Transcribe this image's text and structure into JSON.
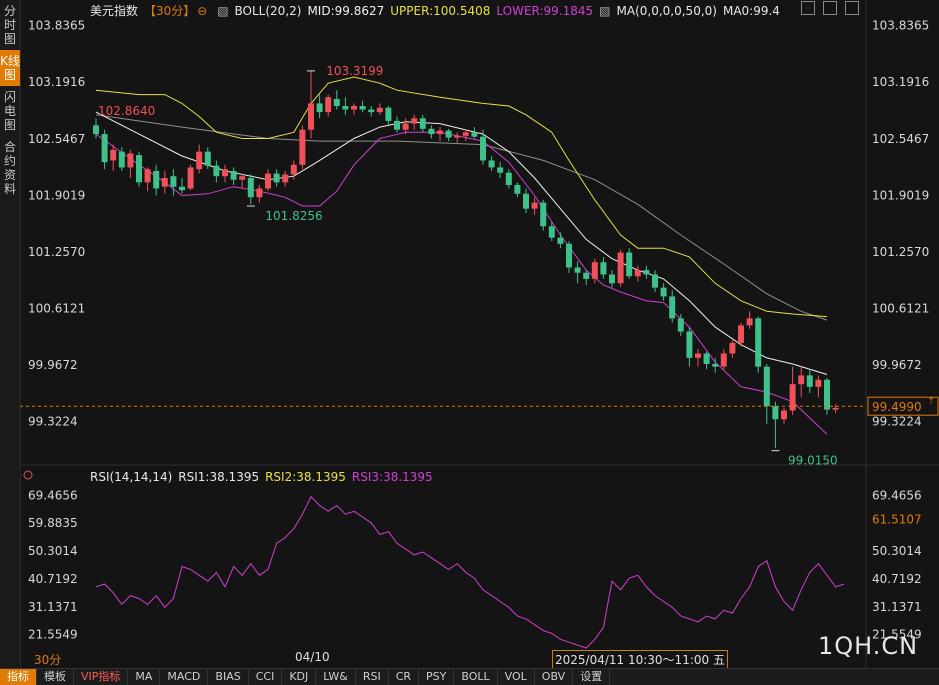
{
  "left_tabs": [
    "分时图",
    "K线图",
    "闪电图",
    "合约资料"
  ],
  "main_header": {
    "symbol": "美元指数",
    "period": "【30分】",
    "boll": "BOLL(20,2)",
    "mid": "MID:99.8627",
    "upper": "UPPER:100.5408",
    "lower": "LOWER:99.1845",
    "ma": "MA(0,0,0,0,50,0)",
    "ma_val": "MA0:99.4"
  },
  "rsi_header": {
    "name": "RSI(14,14,14)",
    "rsi1": "RSI1:38.1395",
    "rsi2": "RSI2:38.1395",
    "rsi3": "RSI3:38.1395"
  },
  "price_axis_labels": [
    "103.8365",
    "103.1916",
    "102.5467",
    "101.9019",
    "101.2570",
    "100.6121",
    "99.9672",
    "99.3224"
  ],
  "rsi_axis_labels": [
    "69.4656",
    "59.8835",
    "50.3014",
    "40.7192",
    "31.1371",
    "21.5549"
  ],
  "current_price": "99.4990",
  "rsi_cursor_value": "61.5107",
  "annotations": {
    "high": "103.3199",
    "left_high": "102.8640",
    "low1": "101.8256",
    "low2": "99.0150"
  },
  "period_label": "30分",
  "date_label": "04/10",
  "time_label": "2025/04/11 10:30～11:00 五",
  "watermark": "1QH.CN",
  "bottom_tabs": [
    "指标",
    "模板",
    "VIP指标",
    "MA",
    "MACD",
    "BIAS",
    "CCI",
    "KDJ",
    "LW&",
    "RSI",
    "CR",
    "PSY",
    "BOLL",
    "VOL",
    "OBV",
    "设置"
  ],
  "colors": {
    "up": "#f0505a",
    "down": "#3ec28a",
    "upper": "#e8e040",
    "lower": "#d040d0",
    "mid": "#f0f0f0",
    "ma50": "#909090",
    "rsi": "#d040d0"
  },
  "chart_data": {
    "type": "candlestick",
    "ylim": [
      99.0,
      103.9
    ],
    "rsi_ylim": [
      17,
      72
    ],
    "candles": [
      [
        102.7,
        102.78,
        102.55,
        102.6
      ],
      [
        102.6,
        102.65,
        102.2,
        102.28
      ],
      [
        102.3,
        102.48,
        102.18,
        102.42
      ],
      [
        102.4,
        102.45,
        102.18,
        102.22
      ],
      [
        102.22,
        102.42,
        102.1,
        102.38
      ],
      [
        102.36,
        102.4,
        102.0,
        102.05
      ],
      [
        102.05,
        102.22,
        101.95,
        102.2
      ],
      [
        102.18,
        102.25,
        101.9,
        101.98
      ],
      [
        102.0,
        102.18,
        101.92,
        102.1
      ],
      [
        102.12,
        102.2,
        101.9,
        102.0
      ],
      [
        102.0,
        102.1,
        101.92,
        101.96
      ],
      [
        101.98,
        102.25,
        101.96,
        102.22
      ],
      [
        102.2,
        102.48,
        102.15,
        102.4
      ],
      [
        102.4,
        102.45,
        102.2,
        102.24
      ],
      [
        102.24,
        102.3,
        102.05,
        102.12
      ],
      [
        102.12,
        102.25,
        102.05,
        102.2
      ],
      [
        102.18,
        102.22,
        102.02,
        102.08
      ],
      [
        102.08,
        102.15,
        101.98,
        102.12
      ],
      [
        102.1,
        102.14,
        101.8,
        101.88
      ],
      [
        101.88,
        102.02,
        101.82,
        101.98
      ],
      [
        101.98,
        102.2,
        101.95,
        102.15
      ],
      [
        102.15,
        102.2,
        102.0,
        102.05
      ],
      [
        102.05,
        102.18,
        102.0,
        102.14
      ],
      [
        102.14,
        102.3,
        102.08,
        102.25
      ],
      [
        102.25,
        102.7,
        102.2,
        102.65
      ],
      [
        102.65,
        103.32,
        102.55,
        102.95
      ],
      [
        102.95,
        103.05,
        102.78,
        102.85
      ],
      [
        102.85,
        103.05,
        102.8,
        103.02
      ],
      [
        103.0,
        103.1,
        102.88,
        102.92
      ],
      [
        102.92,
        103.02,
        102.82,
        102.88
      ],
      [
        102.88,
        102.95,
        102.82,
        102.92
      ],
      [
        102.92,
        102.98,
        102.85,
        102.88
      ],
      [
        102.88,
        102.92,
        102.8,
        102.85
      ],
      [
        102.85,
        102.95,
        102.82,
        102.9
      ],
      [
        102.9,
        102.92,
        102.7,
        102.75
      ],
      [
        102.75,
        102.8,
        102.62,
        102.65
      ],
      [
        102.65,
        102.78,
        102.6,
        102.72
      ],
      [
        102.72,
        102.82,
        102.65,
        102.78
      ],
      [
        102.78,
        102.82,
        102.62,
        102.66
      ],
      [
        102.66,
        102.7,
        102.55,
        102.6
      ],
      [
        102.6,
        102.68,
        102.52,
        102.64
      ],
      [
        102.64,
        102.66,
        102.52,
        102.56
      ],
      [
        102.56,
        102.62,
        102.5,
        102.58
      ],
      [
        102.58,
        102.65,
        102.52,
        102.62
      ],
      [
        102.62,
        102.68,
        102.55,
        102.57
      ],
      [
        102.57,
        102.65,
        102.25,
        102.3
      ],
      [
        102.3,
        102.35,
        102.18,
        102.22
      ],
      [
        102.22,
        102.28,
        102.1,
        102.16
      ],
      [
        102.16,
        102.2,
        101.98,
        102.02
      ],
      [
        102.02,
        102.05,
        101.88,
        101.92
      ],
      [
        101.92,
        101.98,
        101.7,
        101.75
      ],
      [
        101.75,
        101.88,
        101.68,
        101.82
      ],
      [
        101.82,
        101.85,
        101.5,
        101.55
      ],
      [
        101.55,
        101.6,
        101.38,
        101.42
      ],
      [
        101.42,
        101.48,
        101.3,
        101.35
      ],
      [
        101.35,
        101.38,
        101.02,
        101.08
      ],
      [
        101.08,
        101.15,
        100.9,
        101.02
      ],
      [
        101.02,
        101.05,
        100.88,
        100.95
      ],
      [
        100.95,
        101.18,
        100.9,
        101.14
      ],
      [
        101.14,
        101.2,
        100.95,
        101.0
      ],
      [
        101.0,
        101.05,
        100.85,
        100.9
      ],
      [
        100.9,
        101.28,
        100.86,
        101.25
      ],
      [
        101.25,
        101.3,
        100.95,
        100.98
      ],
      [
        100.98,
        101.1,
        100.92,
        101.05
      ],
      [
        101.05,
        101.1,
        100.95,
        101.0
      ],
      [
        101.0,
        101.05,
        100.8,
        100.85
      ],
      [
        100.85,
        100.9,
        100.7,
        100.75
      ],
      [
        100.75,
        100.82,
        100.45,
        100.5
      ],
      [
        100.5,
        100.55,
        100.3,
        100.35
      ],
      [
        100.35,
        100.4,
        99.95,
        100.05
      ],
      [
        100.05,
        100.15,
        99.95,
        100.1
      ],
      [
        100.1,
        100.12,
        99.92,
        99.98
      ],
      [
        99.98,
        100.05,
        99.88,
        99.95
      ],
      [
        99.95,
        100.15,
        99.92,
        100.1
      ],
      [
        100.1,
        100.25,
        100.05,
        100.22
      ],
      [
        100.22,
        100.45,
        100.18,
        100.42
      ],
      [
        100.42,
        100.58,
        100.38,
        100.5
      ],
      [
        100.5,
        100.52,
        99.88,
        99.95
      ],
      [
        99.95,
        99.98,
        99.3,
        99.5
      ],
      [
        99.5,
        99.55,
        99.02,
        99.35
      ],
      [
        99.35,
        99.48,
        99.3,
        99.45
      ],
      [
        99.45,
        99.95,
        99.4,
        99.75
      ],
      [
        99.75,
        99.95,
        99.6,
        99.85
      ],
      [
        99.85,
        99.92,
        99.65,
        99.72
      ],
      [
        99.72,
        99.85,
        99.6,
        99.8
      ],
      [
        99.8,
        99.82,
        99.4,
        99.46
      ],
      [
        99.46,
        99.52,
        99.42,
        99.48
      ]
    ],
    "upper": [
      [
        0,
        103.1
      ],
      [
        5,
        103.05
      ],
      [
        8,
        103.05
      ],
      [
        10,
        102.95
      ],
      [
        12,
        102.8
      ],
      [
        14,
        102.62
      ],
      [
        17,
        102.55
      ],
      [
        20,
        102.55
      ],
      [
        23,
        102.62
      ],
      [
        25,
        102.95
      ],
      [
        27,
        103.18
      ],
      [
        30,
        103.25
      ],
      [
        33,
        103.18
      ],
      [
        35,
        103.1
      ],
      [
        40,
        103.02
      ],
      [
        45,
        102.95
      ],
      [
        48,
        102.92
      ],
      [
        50,
        102.82
      ],
      [
        53,
        102.62
      ],
      [
        55,
        102.3
      ],
      [
        58,
        101.85
      ],
      [
        61,
        101.45
      ],
      [
        63,
        101.3
      ],
      [
        66,
        101.3
      ],
      [
        69,
        101.2
      ],
      [
        72,
        100.9
      ],
      [
        75,
        100.7
      ],
      [
        78,
        100.58
      ],
      [
        81,
        100.55
      ],
      [
        85,
        100.52
      ]
    ],
    "mid": [
      [
        0,
        102.85
      ],
      [
        5,
        102.6
      ],
      [
        10,
        102.35
      ],
      [
        15,
        102.18
      ],
      [
        20,
        102.08
      ],
      [
        23,
        102.12
      ],
      [
        26,
        102.3
      ],
      [
        30,
        102.55
      ],
      [
        33,
        102.68
      ],
      [
        36,
        102.74
      ],
      [
        40,
        102.72
      ],
      [
        45,
        102.6
      ],
      [
        48,
        102.4
      ],
      [
        51,
        102.1
      ],
      [
        54,
        101.75
      ],
      [
        57,
        101.4
      ],
      [
        60,
        101.18
      ],
      [
        63,
        101.05
      ],
      [
        66,
        100.95
      ],
      [
        69,
        100.7
      ],
      [
        72,
        100.4
      ],
      [
        75,
        100.2
      ],
      [
        78,
        100.05
      ],
      [
        81,
        99.98
      ],
      [
        85,
        99.86
      ]
    ],
    "lower": [
      [
        0,
        102.6
      ],
      [
        5,
        102.25
      ],
      [
        8,
        102.05
      ],
      [
        10,
        101.9
      ],
      [
        13,
        101.92
      ],
      [
        16,
        102.0
      ],
      [
        19,
        101.95
      ],
      [
        22,
        101.88
      ],
      [
        24,
        101.78
      ],
      [
        26,
        101.78
      ],
      [
        28,
        101.95
      ],
      [
        30,
        102.25
      ],
      [
        33,
        102.55
      ],
      [
        36,
        102.62
      ],
      [
        40,
        102.62
      ],
      [
        45,
        102.52
      ],
      [
        48,
        102.28
      ],
      [
        51,
        101.9
      ],
      [
        54,
        101.45
      ],
      [
        57,
        101.05
      ],
      [
        59,
        100.88
      ],
      [
        61,
        100.8
      ],
      [
        64,
        100.7
      ],
      [
        66,
        100.68
      ],
      [
        69,
        100.4
      ],
      [
        72,
        100.0
      ],
      [
        75,
        99.72
      ],
      [
        78,
        99.66
      ],
      [
        81,
        99.55
      ],
      [
        85,
        99.18
      ]
    ],
    "ma50": [
      [
        0,
        102.82
      ],
      [
        10,
        102.68
      ],
      [
        20,
        102.55
      ],
      [
        26,
        102.52
      ],
      [
        35,
        102.52
      ],
      [
        45,
        102.48
      ],
      [
        52,
        102.3
      ],
      [
        58,
        102.08
      ],
      [
        63,
        101.8
      ],
      [
        68,
        101.45
      ],
      [
        73,
        101.12
      ],
      [
        78,
        100.78
      ],
      [
        82,
        100.58
      ],
      [
        85,
        100.48
      ]
    ],
    "rsi": [
      [
        0,
        38
      ],
      [
        1,
        39
      ],
      [
        2,
        36
      ],
      [
        3,
        32
      ],
      [
        4,
        35
      ],
      [
        5,
        34
      ],
      [
        6,
        32
      ],
      [
        7,
        35
      ],
      [
        8,
        31
      ],
      [
        9,
        34
      ],
      [
        10,
        45
      ],
      [
        11,
        44
      ],
      [
        12,
        42
      ],
      [
        13,
        40
      ],
      [
        14,
        43
      ],
      [
        15,
        38
      ],
      [
        16,
        45
      ],
      [
        17,
        42
      ],
      [
        18,
        46
      ],
      [
        19,
        42
      ],
      [
        20,
        44
      ],
      [
        21,
        53
      ],
      [
        22,
        55
      ],
      [
        23,
        58
      ],
      [
        24,
        63
      ],
      [
        25,
        69
      ],
      [
        26,
        66
      ],
      [
        27,
        64
      ],
      [
        28,
        66
      ],
      [
        29,
        63
      ],
      [
        30,
        64
      ],
      [
        31,
        62
      ],
      [
        32,
        60
      ],
      [
        33,
        56
      ],
      [
        34,
        57
      ],
      [
        35,
        53
      ],
      [
        36,
        51
      ],
      [
        37,
        49
      ],
      [
        38,
        50
      ],
      [
        39,
        48
      ],
      [
        40,
        46
      ],
      [
        41,
        44
      ],
      [
        42,
        46
      ],
      [
        43,
        43
      ],
      [
        44,
        41
      ],
      [
        45,
        37
      ],
      [
        46,
        35
      ],
      [
        47,
        33
      ],
      [
        48,
        31
      ],
      [
        49,
        28
      ],
      [
        50,
        27
      ],
      [
        51,
        25
      ],
      [
        52,
        23
      ],
      [
        53,
        22
      ],
      [
        54,
        20
      ],
      [
        55,
        19
      ],
      [
        56,
        18
      ],
      [
        57,
        17
      ],
      [
        58,
        20
      ],
      [
        59,
        24
      ],
      [
        60,
        40
      ],
      [
        61,
        37
      ],
      [
        62,
        41
      ],
      [
        63,
        42
      ],
      [
        64,
        38
      ],
      [
        65,
        35
      ],
      [
        66,
        33
      ],
      [
        67,
        31
      ],
      [
        68,
        28
      ],
      [
        69,
        27
      ],
      [
        70,
        26
      ],
      [
        71,
        28
      ],
      [
        72,
        27
      ],
      [
        73,
        30
      ],
      [
        74,
        29
      ],
      [
        75,
        34
      ],
      [
        76,
        38
      ],
      [
        77,
        45
      ],
      [
        78,
        47
      ],
      [
        79,
        38
      ],
      [
        80,
        33
      ],
      [
        81,
        30
      ],
      [
        82,
        37
      ],
      [
        83,
        43
      ],
      [
        84,
        46
      ],
      [
        85,
        42
      ],
      [
        86,
        38
      ],
      [
        87,
        39
      ]
    ]
  }
}
